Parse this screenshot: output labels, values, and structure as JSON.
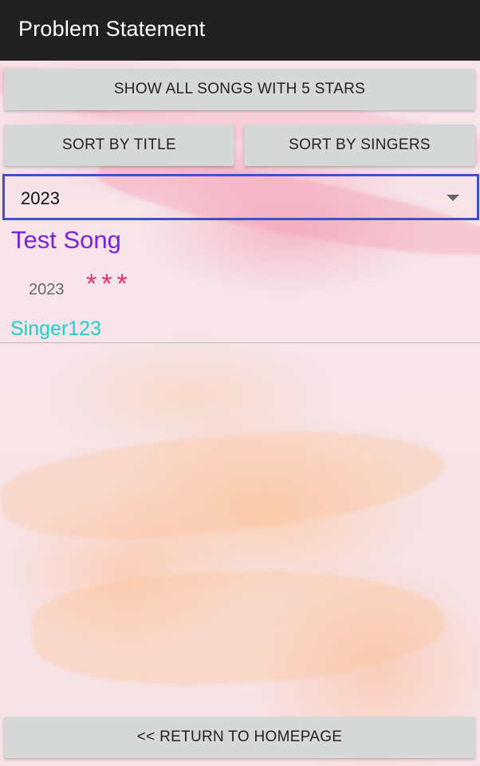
{
  "app_bar": {
    "title": "Problem Statement"
  },
  "buttons": {
    "five_stars": "SHOW ALL SONGS WITH 5 STARS",
    "sort_title": "SORT BY TITLE",
    "sort_singers": "SORT BY SINGERS",
    "return_home": "<< RETURN TO HOMEPAGE"
  },
  "year_filter": {
    "selected": "2023"
  },
  "songs": [
    {
      "title": "Test Song",
      "year": "2023",
      "stars": "***",
      "singer": "Singer123"
    }
  ],
  "colors": {
    "app_bar": "#212121",
    "spinner_border": "#3f4fd0",
    "song_title": "#7b22e0",
    "stars": "#e3306a",
    "singer": "#1fcfc5"
  }
}
